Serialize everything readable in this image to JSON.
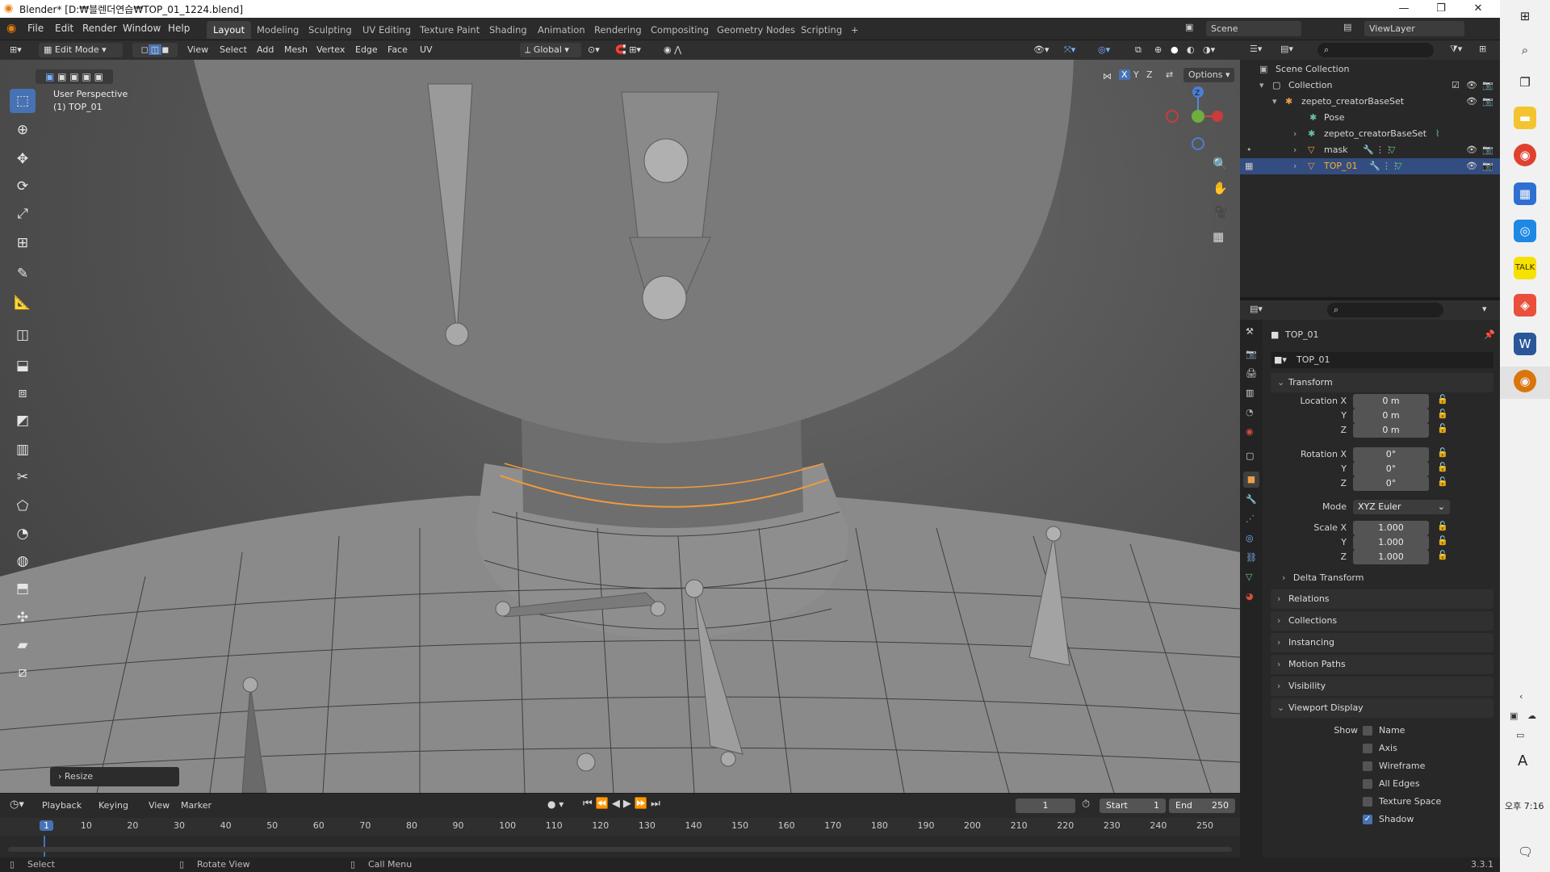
{
  "window": {
    "title": "Blender* [D:₩블렌더연습₩TOP_01_1224.blend]"
  },
  "menu": [
    "File",
    "Edit",
    "Render",
    "Window",
    "Help"
  ],
  "workspaces": [
    "Layout",
    "Modeling",
    "Sculpting",
    "UV Editing",
    "Texture Paint",
    "Shading",
    "Animation",
    "Rendering",
    "Compositing",
    "Geometry Nodes",
    "Scripting"
  ],
  "scene": {
    "scene_name": "Scene",
    "view_layer": "ViewLayer"
  },
  "viewport_header": {
    "mode": "Edit Mode",
    "menus": [
      "View",
      "Select",
      "Add",
      "Mesh",
      "Vertex",
      "Edge",
      "Face",
      "UV"
    ],
    "orientation": "Global",
    "options": "Options",
    "axes": [
      "X",
      "Y",
      "Z"
    ]
  },
  "viewport": {
    "perspective": "User Perspective",
    "object_label": "(1) TOP_01",
    "last_op": "Resize"
  },
  "gizmo": {
    "z": "Z",
    "y": "Y"
  },
  "timeline": {
    "menus": [
      "Playback",
      "Keying",
      "View",
      "Marker"
    ],
    "current_frame": "1",
    "start_label": "Start",
    "start": "1",
    "end_label": "End",
    "end": "250",
    "ruler": [
      "1",
      "10",
      "20",
      "30",
      "40",
      "50",
      "60",
      "70",
      "80",
      "90",
      "100",
      "110",
      "120",
      "130",
      "140",
      "150",
      "160",
      "170",
      "180",
      "190",
      "200",
      "210",
      "220",
      "230",
      "240",
      "250"
    ]
  },
  "status": {
    "select": "Select",
    "rotate": "Rotate View",
    "call_menu": "Call Menu",
    "version": "3.3.1"
  },
  "outliner": {
    "rows": [
      {
        "label": "Scene Collection",
        "indent": 0
      },
      {
        "label": "Collection",
        "indent": 1
      },
      {
        "label": "zepeto_creatorBaseSet",
        "indent": 2
      },
      {
        "label": "Pose",
        "indent": 3
      },
      {
        "label": "zepeto_creatorBaseSet",
        "indent": 3
      },
      {
        "label": "mask",
        "indent": 3
      },
      {
        "label": "TOP_01",
        "indent": 3
      }
    ]
  },
  "properties": {
    "object_name": "TOP_01",
    "data_name": "TOP_01",
    "transform_title": "Transform",
    "location": {
      "label": "Location X",
      "x": "0 m",
      "y": "0 m",
      "z": "0 m"
    },
    "rotation": {
      "label": "Rotation X",
      "x": "0°",
      "y": "0°",
      "z": "0°"
    },
    "mode_label": "Mode",
    "mode_value": "XYZ Euler",
    "scale": {
      "label": "Scale X",
      "x": "1.000",
      "y": "1.000",
      "z": "1.000"
    },
    "y_label": "Y",
    "z_label": "Z",
    "delta": "Delta Transform",
    "sections": [
      "Relations",
      "Collections",
      "Instancing",
      "Motion Paths",
      "Visibility"
    ],
    "viewport_display": "Viewport Display",
    "show_label": "Show",
    "show_items": [
      "Name",
      "Axis",
      "Wireframe",
      "All Edges",
      "Texture Space",
      "Shadow"
    ]
  },
  "clock": {
    "time": "오후 7:16"
  },
  "taskbar": {
    "font_glyph": "A"
  }
}
